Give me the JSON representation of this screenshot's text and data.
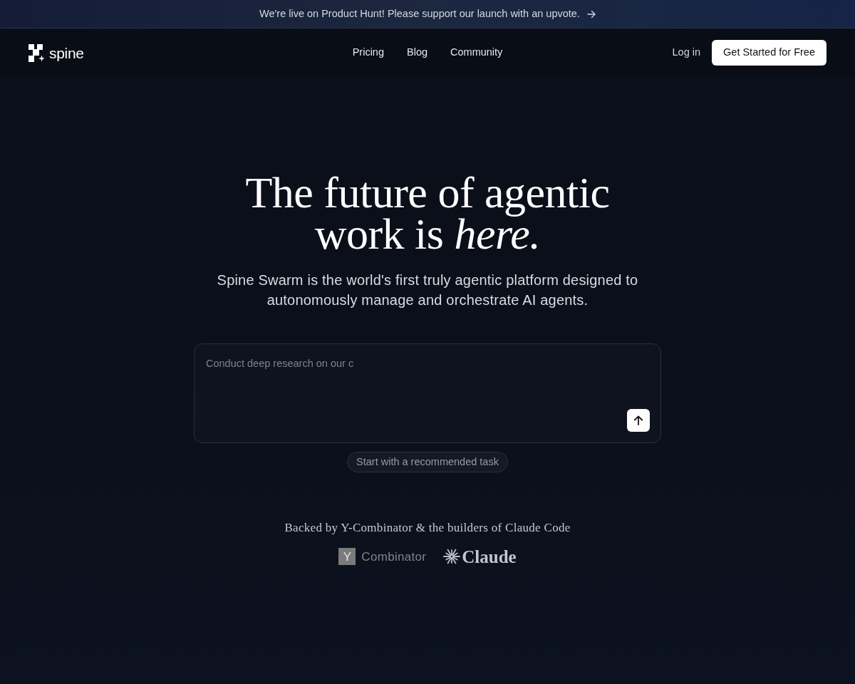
{
  "banner": {
    "text": "We're live on Product Hunt! Please support our launch with an upvote."
  },
  "nav": {
    "logo_text": "spine",
    "links": [
      {
        "label": "Pricing"
      },
      {
        "label": "Blog"
      },
      {
        "label": "Community"
      }
    ],
    "login": "Log in",
    "cta": "Get Started for Free"
  },
  "hero": {
    "title_lines": [
      "The future of agentic",
      "work is *here.*"
    ],
    "subtitle": "Spine Swarm is the world's first truly agentic platform designed to autonomously manage and orchestrate AI agents."
  },
  "prompt": {
    "placeholder": "Conduct deep research on our c",
    "suggestion": "Start with a recommended task"
  },
  "backers": {
    "text": "Backed by Y-Combinator & the builders of Claude Code",
    "logos": [
      {
        "kind": "yc",
        "mark": "Y",
        "name": "Combinator"
      },
      {
        "kind": "claude",
        "name": "Claude"
      }
    ]
  }
}
